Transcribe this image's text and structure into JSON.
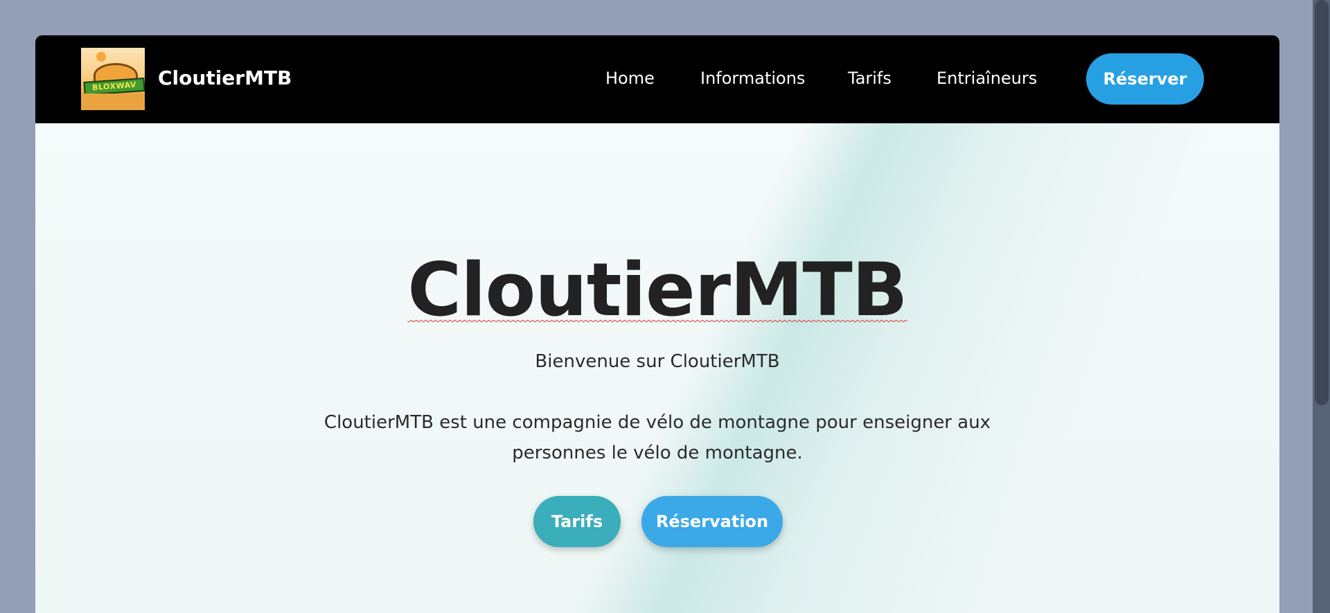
{
  "header": {
    "logo_text": "BLOXWAV",
    "brand": "CloutierMTB",
    "nav": [
      {
        "label": "Home"
      },
      {
        "label": "Informations"
      },
      {
        "label": "Tarifs"
      },
      {
        "label": "Entriaîneurs"
      }
    ],
    "reserve_label": "Réserver"
  },
  "hero": {
    "title": "CloutierMTB",
    "subtitle": "Bienvenue sur CloutierMTB",
    "description": "CloutierMTB est une compagnie de vélo de montagne pour enseigner aux personnes le vélo de montagne.",
    "buttons": [
      {
        "label": "Tarifs"
      },
      {
        "label": "Réservation"
      }
    ]
  },
  "colors": {
    "page_background": "#929fb6",
    "navbar": "#000000",
    "accent_blue": "#27a0e3",
    "accent_teal": "#3aaebb",
    "title_text": "#222222",
    "spellcheck_underline": "#d9302c"
  }
}
